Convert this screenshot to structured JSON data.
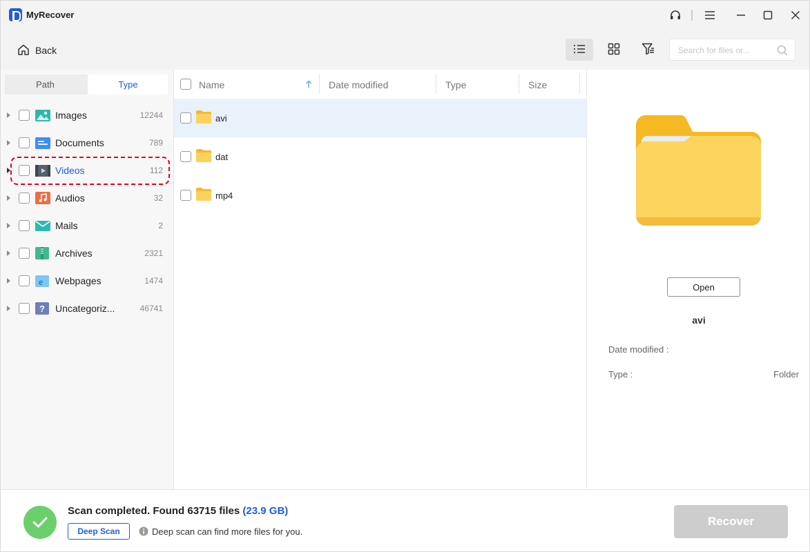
{
  "app": {
    "title": "MyRecover"
  },
  "toolbar": {
    "back_label": "Back"
  },
  "search": {
    "placeholder": "Search for files or..."
  },
  "tabs": {
    "path_label": "Path",
    "type_label": "Type",
    "active": "Type"
  },
  "categories": [
    {
      "label": "Images",
      "count": "12244",
      "icon": "images-icon"
    },
    {
      "label": "Documents",
      "count": "789",
      "icon": "documents-icon"
    },
    {
      "label": "Videos",
      "count": "112",
      "icon": "videos-icon",
      "selected": true
    },
    {
      "label": "Audios",
      "count": "32",
      "icon": "audios-icon"
    },
    {
      "label": "Mails",
      "count": "2",
      "icon": "mails-icon"
    },
    {
      "label": "Archives",
      "count": "2321",
      "icon": "archives-icon"
    },
    {
      "label": "Webpages",
      "count": "1474",
      "icon": "webpages-icon"
    },
    {
      "label": "Uncategoriz...",
      "count": "46741",
      "icon": "uncategorized-icon"
    }
  ],
  "columns": {
    "name": "Name",
    "date_modified": "Date modified",
    "type": "Type",
    "size": "Size"
  },
  "files": [
    {
      "name": "avi",
      "selected": true
    },
    {
      "name": "dat"
    },
    {
      "name": "mp4"
    }
  ],
  "preview": {
    "open_label": "Open",
    "name": "avi",
    "date_modified_label": "Date modified :",
    "date_modified_value": "",
    "type_label": "Type :",
    "type_value": "Folder"
  },
  "footer": {
    "status_text": "Scan completed. Found 63715 files",
    "size_text": "(23.9 GB)",
    "deep_scan_label": "Deep Scan",
    "hint": "Deep scan can find more files for you.",
    "recover_label": "Recover"
  },
  "colors": {
    "accent": "#1f5fd6",
    "selected_row": "#e9f1fb",
    "highlight": "#e0001b",
    "success": "#6bd06b",
    "folder": "#f9c94a"
  }
}
